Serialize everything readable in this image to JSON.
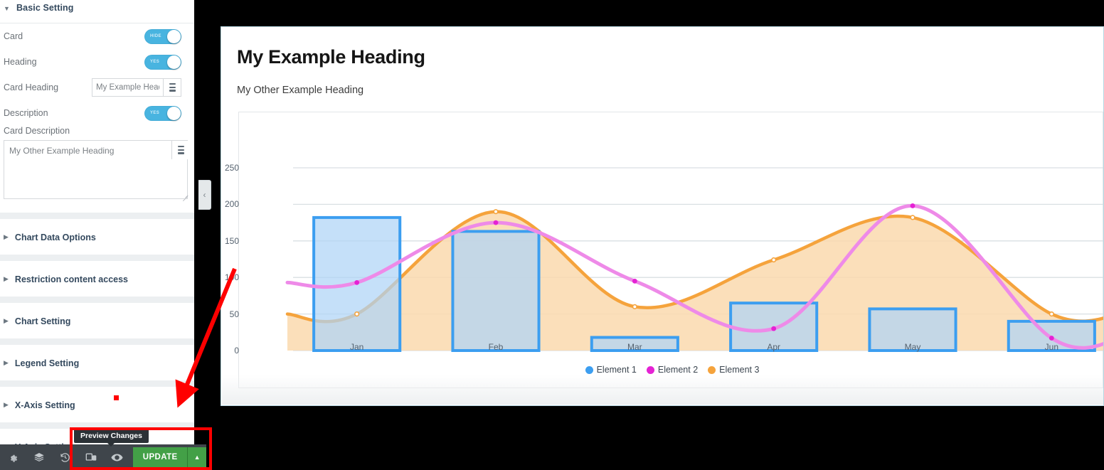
{
  "sidebar": {
    "basic_setting": {
      "title": "Basic Setting",
      "caret": "caret-down-icon",
      "rows": [
        {
          "label": "Card",
          "toggle_text": "HIDE",
          "type": "toggle"
        },
        {
          "label": "Heading",
          "toggle_text": "YES",
          "type": "toggle"
        },
        {
          "label": "Card Heading",
          "value": "My Example Headi",
          "placeholder": "Card Heading",
          "type": "input"
        },
        {
          "label": "Description",
          "toggle_text": "YES",
          "type": "toggle"
        }
      ],
      "textarea": {
        "label": "Card Description",
        "value": "My Other Example Heading",
        "placeholder": "Card Description"
      },
      "db_icon": "database-icon"
    },
    "accordions": [
      {
        "label": "Chart Data Options",
        "caret": "caret-right-icon"
      },
      {
        "label": "Restriction content access",
        "caret": "caret-right-icon"
      },
      {
        "label": "Chart Setting",
        "caret": "caret-right-icon"
      },
      {
        "label": "Legend Setting",
        "caret": "caret-right-icon"
      },
      {
        "label": "X-Axis Setting",
        "caret": "caret-right-icon"
      },
      {
        "label": "Y-Axis Setting",
        "caret": "caret-right-icon"
      }
    ],
    "collapse_handle": "‹"
  },
  "bottombar": {
    "icons": [
      {
        "name": "settings-gear-icon"
      },
      {
        "name": "layers-icon"
      },
      {
        "name": "history-icon"
      },
      {
        "name": "responsive-mode-icon"
      },
      {
        "name": "preview-eye-icon"
      }
    ],
    "update_label": "UPDATE",
    "update_caret": "▲",
    "tooltip": "Preview Changes"
  },
  "annotation": {
    "arrow_color": "#ff0000",
    "box_color": "#ff0000"
  },
  "preview": {
    "heading": "My Example Heading",
    "subheading": "My Other Example Heading"
  },
  "chart_data": {
    "type": "bar",
    "title": "My Example Heading",
    "subtitle": "My Other Example Heading",
    "categories": [
      "Jan",
      "Feb",
      "Mar",
      "Apr",
      "May",
      "Jun"
    ],
    "series": [
      {
        "name": "Element 1",
        "type": "bar",
        "color": "#3c9ef0",
        "fill": "#aed4f7",
        "values": [
          182,
          163,
          18,
          65,
          57,
          40
        ]
      },
      {
        "name": "Element 2",
        "type": "line",
        "color": "#ee8ae8",
        "point": "#e522d4",
        "values": [
          93,
          175,
          95,
          30,
          198,
          17
        ]
      },
      {
        "name": "Element 3",
        "type": "area",
        "color": "#f5a33c",
        "fill": "#fad9ae",
        "values": [
          50,
          190,
          60,
          124,
          182,
          50
        ]
      }
    ],
    "yticks": [
      0,
      50,
      100,
      150,
      200,
      250
    ],
    "ylim": [
      0,
      250
    ],
    "xlabel": "",
    "ylabel": "",
    "grid": true,
    "legend_position": "bottom"
  }
}
